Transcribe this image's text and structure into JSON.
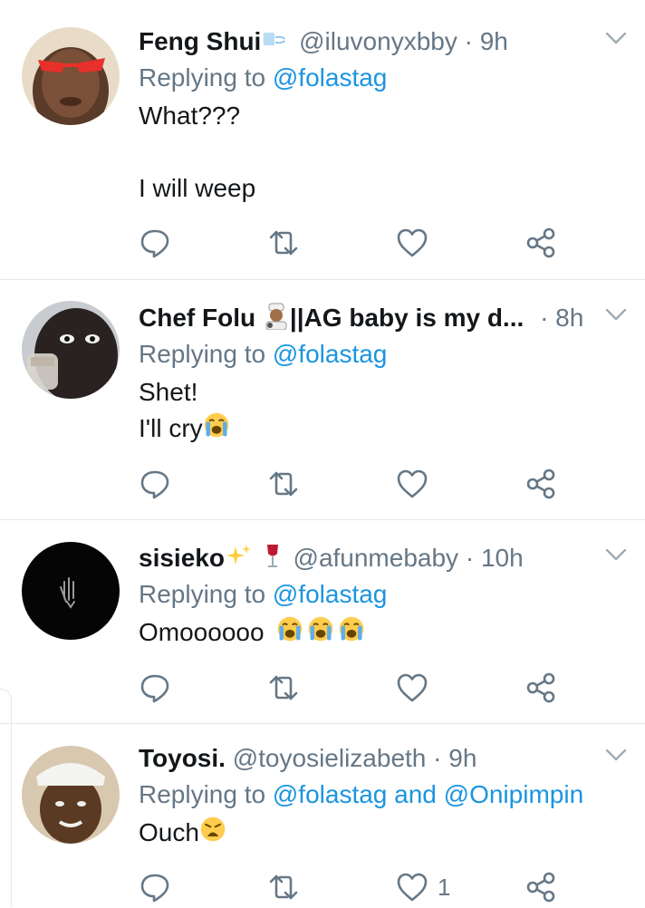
{
  "replies": [
    {
      "name": "Feng Shui",
      "handle": "@iluvonyxbby",
      "separator": "·",
      "time": "9h",
      "replying_label": "Replying to",
      "mentions": [
        "@folastag"
      ],
      "joiner": "",
      "text_lines": [
        "What???",
        "",
        "I will weep"
      ],
      "like_count": ""
    },
    {
      "name": "Chef Folu",
      "name_suffix": "||AG baby is my d...",
      "handle": "",
      "separator": "·",
      "time": "8h",
      "replying_label": "Replying to",
      "mentions": [
        "@folastag"
      ],
      "joiner": "",
      "text_lines": [
        "Shet!",
        "I'll cry"
      ],
      "like_count": ""
    },
    {
      "name": "sisieko",
      "handle": "@afunmebaby",
      "separator": "·",
      "time": "10h",
      "replying_label": "Replying to",
      "mentions": [
        "@folastag"
      ],
      "joiner": "",
      "text_lines": [
        "Omoooooo"
      ],
      "like_count": ""
    },
    {
      "name": "Toyosi.",
      "handle": "@toyosielizabeth",
      "separator": "·",
      "time": "9h",
      "replying_label": "Replying to",
      "mentions": [
        "@folastag",
        "@Onipimpin"
      ],
      "joiner": "and",
      "text_lines": [
        "Ouch"
      ],
      "like_count": "1"
    }
  ],
  "icons": {
    "reply": "reply-icon",
    "retweet": "retweet-icon",
    "like": "heart-icon",
    "share": "share-icon",
    "caret": "chevron-down-icon"
  },
  "colors": {
    "link": "#1b95e0",
    "muted": "#657786",
    "text": "#14171a",
    "divider": "#e1e8ed"
  }
}
